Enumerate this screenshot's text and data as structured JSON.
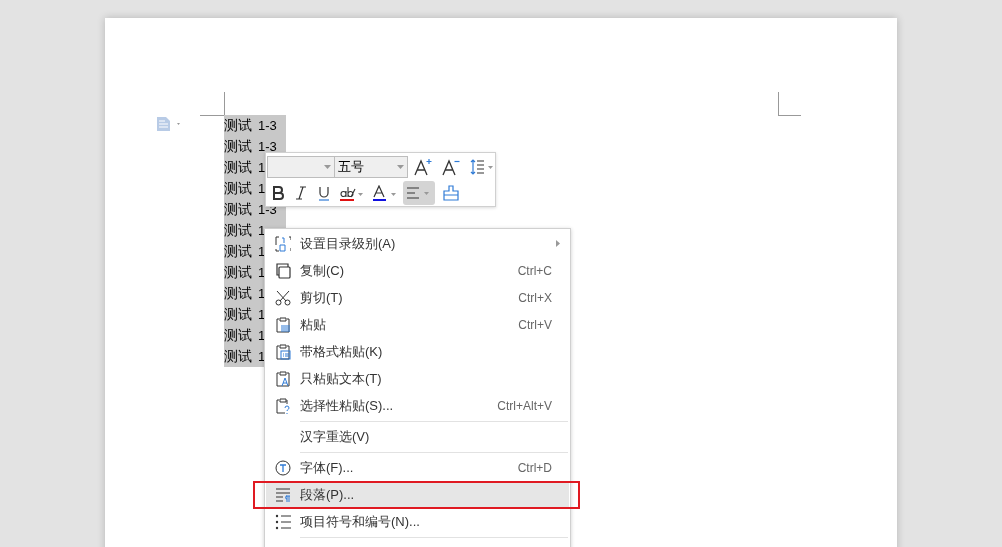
{
  "document": {
    "lines": [
      {
        "text": "测试",
        "number": "1-3"
      },
      {
        "text": "测试",
        "number": "1-3"
      },
      {
        "text": "测试",
        "number": "1"
      },
      {
        "text": "测试",
        "number": "1"
      },
      {
        "text": "测试",
        "number": "1-3"
      },
      {
        "text": "测试",
        "number": "1"
      },
      {
        "text": "测试",
        "number": "1"
      },
      {
        "text": "测试",
        "number": "1"
      },
      {
        "text": "测试",
        "number": "1"
      },
      {
        "text": "测试",
        "number": "1"
      },
      {
        "text": "测试",
        "number": "1"
      },
      {
        "text": "测试",
        "number": "1"
      }
    ]
  },
  "mini_toolbar": {
    "font_size": {
      "value": "五号"
    },
    "buttons": [
      {
        "kind": "bold",
        "selected": false
      },
      {
        "kind": "italic",
        "selected": false
      },
      {
        "kind": "underline",
        "selected": false
      },
      {
        "kind": "highlight",
        "selected": false
      },
      {
        "kind": "font-color",
        "selected": false
      },
      {
        "kind": "align",
        "selected": true
      },
      {
        "kind": "format-painter",
        "selected": false
      }
    ]
  },
  "context_menu": {
    "items": [
      {
        "kind": "levels",
        "label": "设置目录级别(A)",
        "has_submenu": true,
        "selected": false,
        "separator_after": false
      },
      {
        "kind": "copy",
        "label": "复制(C)",
        "shortcut": "Ctrl+C",
        "selected": false,
        "separator_after": false
      },
      {
        "kind": "cut",
        "label": "剪切(T)",
        "shortcut": "Ctrl+X",
        "selected": false,
        "separator_after": false
      },
      {
        "kind": "paste",
        "label": "粘贴",
        "shortcut": "Ctrl+V",
        "selected": false,
        "separator_after": false
      },
      {
        "kind": "paste-format",
        "label": "带格式粘贴(K)",
        "selected": false,
        "separator_after": false
      },
      {
        "kind": "paste-text",
        "label": "只粘贴文本(T)",
        "selected": false,
        "separator_after": false
      },
      {
        "kind": "paste-special",
        "label": "选择性粘贴(S)...",
        "shortcut": "Ctrl+Alt+V",
        "selected": false,
        "separator_after": true
      },
      {
        "kind": "none",
        "label": "汉字重选(V)",
        "selected": false,
        "separator_after": true
      },
      {
        "kind": "font",
        "label": "字体(F)...",
        "shortcut": "Ctrl+D",
        "selected": false,
        "separator_after": false
      },
      {
        "kind": "paragraph",
        "label": "段落(P)...",
        "selected": true,
        "outlined": true,
        "separator_after": false
      },
      {
        "kind": "list",
        "label": "项目符号和编号(N)...",
        "selected": false,
        "separator_after": true
      }
    ]
  }
}
